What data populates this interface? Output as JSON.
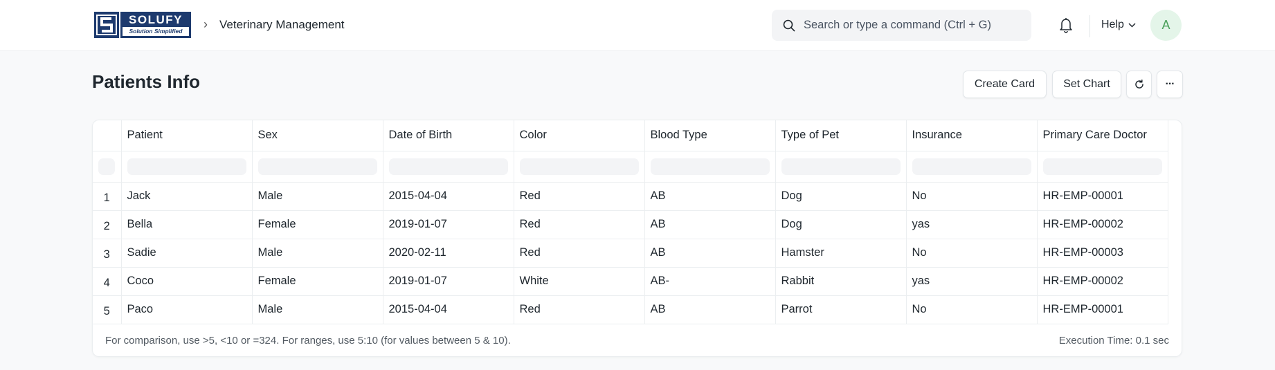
{
  "navbar": {
    "logo": {
      "brand": "SOLUFY",
      "tagline": "Solution Simplified"
    },
    "breadcrumb_separator": "›",
    "breadcrumb": "Veterinary Management",
    "search": {
      "placeholder": "Search or type a command (Ctrl + G)",
      "value": ""
    },
    "help_label": "Help",
    "avatar_initial": "A"
  },
  "page": {
    "title": "Patients Info",
    "actions": {
      "create_card": "Create Card",
      "set_chart": "Set Chart",
      "refresh_icon": "refresh-icon",
      "more_icon": "···"
    }
  },
  "report": {
    "columns": [
      "Patient",
      "Sex",
      "Date of Birth",
      "Color",
      "Blood Type",
      "Type of Pet",
      "Insurance",
      "Primary Care Doctor"
    ],
    "rows": [
      {
        "index": "1",
        "cells": [
          "Jack",
          "Male",
          "2015-04-04",
          "Red",
          "AB",
          "Dog",
          "No",
          "HR-EMP-00001"
        ]
      },
      {
        "index": "2",
        "cells": [
          "Bella",
          "Female",
          "2019-01-07",
          "Red",
          "AB",
          "Dog",
          "yas",
          "HR-EMP-00002"
        ]
      },
      {
        "index": "3",
        "cells": [
          "Sadie",
          "Male",
          "2020-02-11",
          "Red",
          "AB",
          "Hamster",
          "No",
          "HR-EMP-00003"
        ]
      },
      {
        "index": "4",
        "cells": [
          "Coco",
          "Female",
          "2019-01-07",
          "White",
          "AB-",
          "Rabbit",
          "yas",
          "HR-EMP-00002"
        ]
      },
      {
        "index": "5",
        "cells": [
          "Paco",
          "Male",
          "2015-04-04",
          "Red",
          "AB",
          "Parrot",
          "No",
          "HR-EMP-00001"
        ]
      }
    ],
    "footer_hint": "For comparison, use >5, <10 or =324. For ranges, use 5:10 (for values between 5 & 10).",
    "execution_time": "Execution Time: 0.1 sec"
  },
  "colors": {
    "brand": "#1d3a6e",
    "avatar_bg": "#e4f5e9",
    "avatar_fg": "#4aa05a"
  }
}
